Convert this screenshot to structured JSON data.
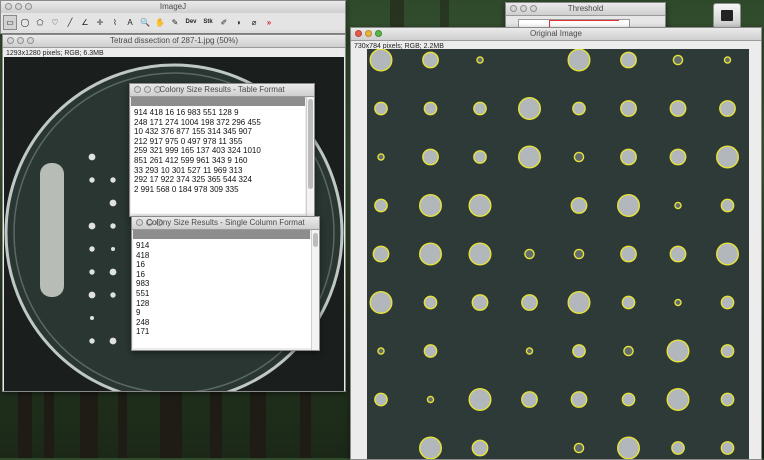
{
  "imagej": {
    "title": "ImageJ",
    "tools": [
      {
        "name": "rectangle-tool",
        "glyph": "▭"
      },
      {
        "name": "oval-tool",
        "glyph": "◯"
      },
      {
        "name": "polygon-tool",
        "glyph": "⬠"
      },
      {
        "name": "freehand-tool",
        "glyph": "♡"
      },
      {
        "name": "line-tool",
        "glyph": "╱"
      },
      {
        "name": "angle-tool",
        "glyph": "∠"
      },
      {
        "name": "point-tool",
        "glyph": "✛"
      },
      {
        "name": "wand-tool",
        "glyph": "⌇"
      },
      {
        "name": "text-tool",
        "glyph": "A"
      },
      {
        "name": "magnifier-tool",
        "glyph": "🔍"
      },
      {
        "name": "hand-tool",
        "glyph": "✋"
      },
      {
        "name": "dropper-tool",
        "glyph": "✎"
      },
      {
        "name": "dev-tool",
        "glyph": "Dev"
      },
      {
        "name": "stk-tool",
        "glyph": "Stk"
      },
      {
        "name": "brush-tool",
        "glyph": "✐"
      },
      {
        "name": "flood-tool",
        "glyph": "◗"
      },
      {
        "name": "pick-tool",
        "glyph": "⌀"
      },
      {
        "name": "more-tools",
        "glyph": "»"
      }
    ]
  },
  "threshold": {
    "title": "Threshold"
  },
  "tetrad": {
    "title": "Tetrad dissection of 287-1.jpg (50%)",
    "info": "1293x1280 pixels; RGB; 6.3MB"
  },
  "original": {
    "title": "Original Image",
    "info": "730x784 pixels; RGB; 2.2MB",
    "colony_grid": {
      "col_count": 8,
      "row_count": 8,
      "rows": [
        [
          6,
          4,
          1,
          0,
          6,
          4,
          2,
          1
        ],
        [
          3,
          3,
          3,
          6,
          3,
          4,
          4,
          4
        ],
        [
          1,
          4,
          3,
          6,
          2,
          4,
          4,
          6
        ],
        [
          3,
          6,
          6,
          0,
          4,
          6,
          1,
          3
        ],
        [
          4,
          6,
          6,
          2,
          2,
          4,
          4,
          6
        ],
        [
          6,
          3,
          4,
          4,
          6,
          3,
          1,
          3
        ],
        [
          1,
          3,
          0,
          1,
          3,
          2,
          6,
          3
        ],
        [
          3,
          1,
          6,
          4,
          4,
          3,
          6,
          3
        ],
        [
          0,
          6,
          4,
          0,
          2,
          6,
          3,
          3
        ]
      ]
    }
  },
  "table_format": {
    "title": "Colony Size Results - Table Format",
    "lines": [
      "914 418 16 16 983 551 128 9",
      "248 171 274 1004 198 372 296 455",
      "10 432 376 877 155 314 345 907",
      "212 917 975 0 497 978 11 355",
      "259 321 999 165 137 403 324 1010",
      "851 261 412 599 961 343 9 160",
      "33 293 10 301 527 11 969 313",
      "292 17 922 374 325 365 544 324",
      "2 991 568 0 184 978 309 335"
    ]
  },
  "single_column": {
    "title": "Colony Size Results - Single Column Format",
    "lines": [
      "914",
      "418",
      "16",
      "16",
      "983",
      "551",
      "128",
      "9",
      "248",
      "171"
    ]
  },
  "colors": {
    "plate_bg": "#2c3b36",
    "grid_bg": "#33403d",
    "circle": "#e6e23a",
    "colony": "#c9ced3"
  }
}
